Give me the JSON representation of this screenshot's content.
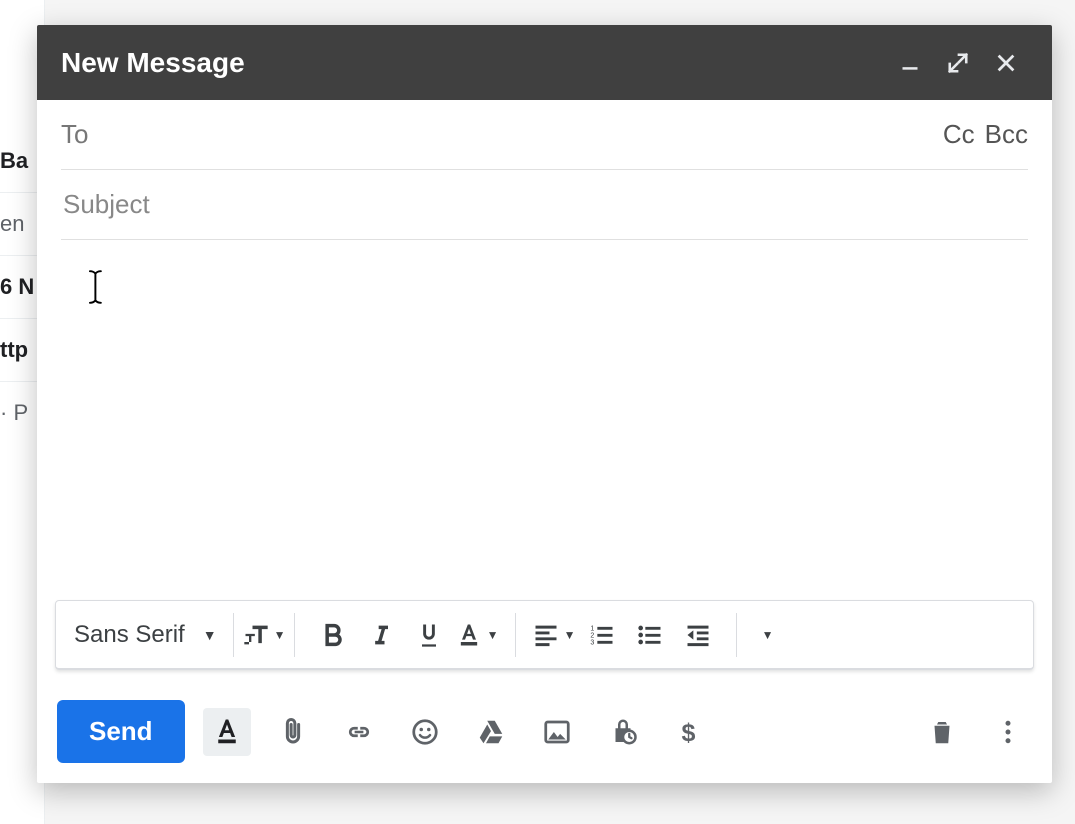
{
  "background_items": [
    "Ba",
    "en",
    "6 N",
    "ttp",
    "· P"
  ],
  "header": {
    "title": "New Message"
  },
  "fields": {
    "to_label": "To",
    "cc_label": "Cc",
    "bcc_label": "Bcc",
    "subject_placeholder": "Subject",
    "to_value": "",
    "subject_value": ""
  },
  "toolbar": {
    "font_label": "Sans Serif"
  },
  "actions": {
    "send_label": "Send"
  }
}
